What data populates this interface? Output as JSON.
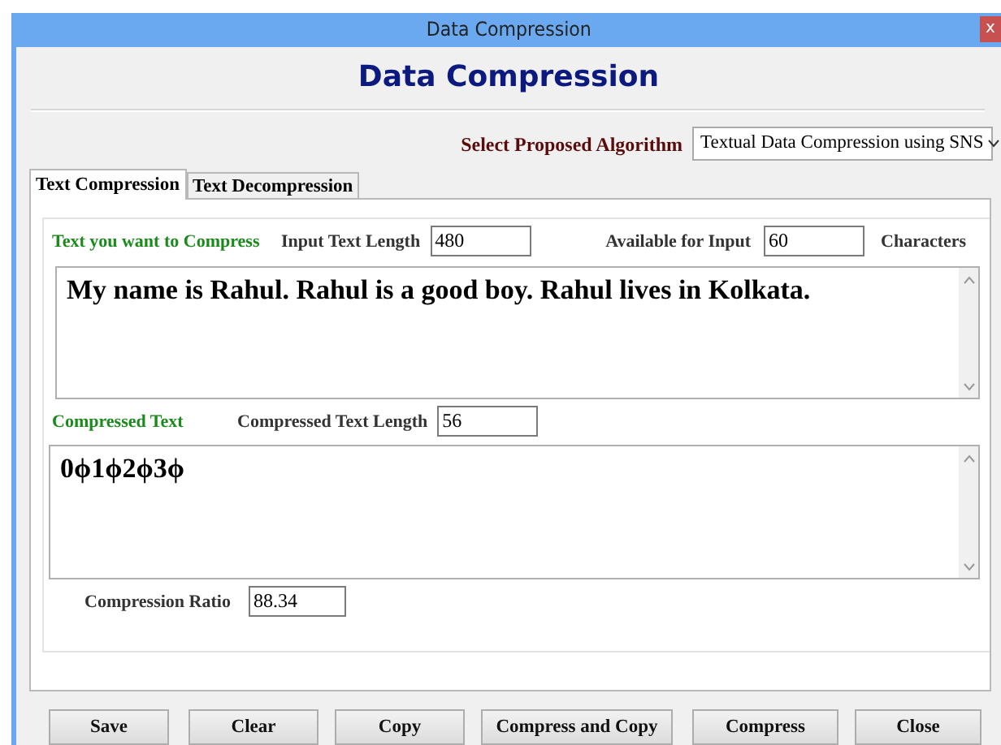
{
  "window": {
    "title": "Data Compression",
    "close_glyph": "x"
  },
  "heading": "Data Compression",
  "algorithm": {
    "label": "Select Proposed Algorithm",
    "value": "Textual Data Compression using SNS"
  },
  "tabs": [
    {
      "label": "Text Compression",
      "selected": true
    },
    {
      "label": "Text Decompression",
      "selected": false
    }
  ],
  "input_section": {
    "label": "Text you want to Compress",
    "length_label": "Input Text Length",
    "length": "480",
    "available_label": "Available for Input",
    "available": "60",
    "unit": "Characters",
    "text": "My name is Rahul. Rahul is a good boy. Rahul lives in Kolkata."
  },
  "output_section": {
    "label": "Compressed Text",
    "length_label": "Compressed Text Length",
    "length": "56",
    "text": "0ϕ1ϕ2ϕ3ϕ"
  },
  "ratio": {
    "label": "Compression Ratio",
    "value": "88.34"
  },
  "buttons": [
    "Save",
    "Clear",
    "Copy",
    "Compress and Copy",
    "Compress",
    "Close"
  ]
}
